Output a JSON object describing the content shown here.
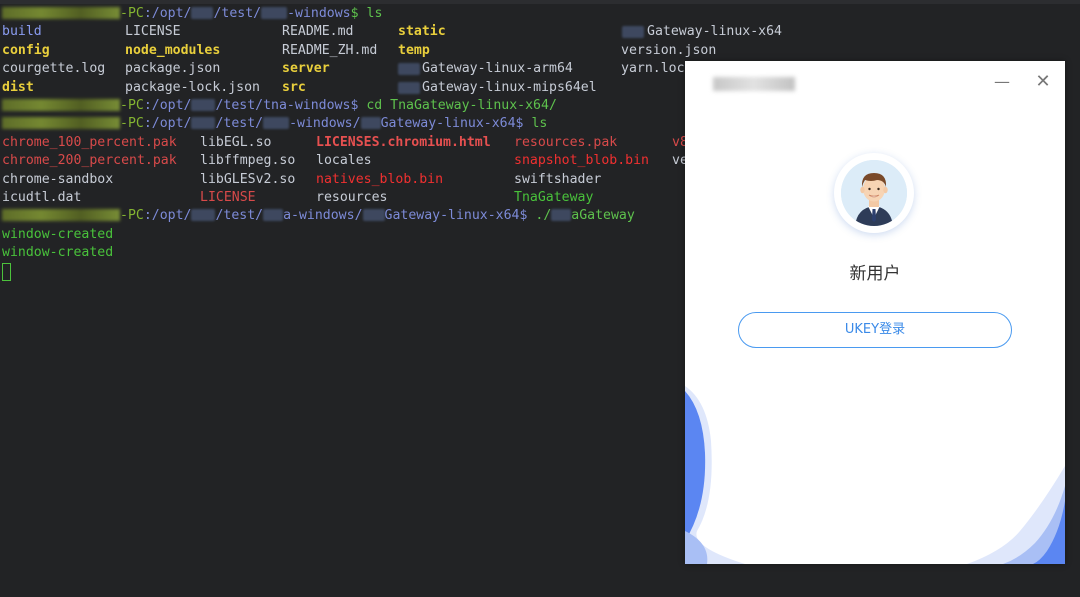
{
  "terminal": {
    "lines": [
      {
        "type": "prompt",
        "path": ":/opt/",
        "p2": "/test/",
        "p3": "-windows",
        "cmd": "$ ls"
      },
      {
        "type": "files",
        "cols": [
          {
            "text": "build",
            "cls": "fileb"
          },
          {
            "text": "LICENSE",
            "cls": "white"
          },
          {
            "text": "README.md",
            "cls": "white"
          },
          {
            "text": "static",
            "cls": "dir"
          },
          {
            "text": "Gateway-linux-x64",
            "cls": "white"
          }
        ]
      },
      {
        "type": "files",
        "cols": [
          {
            "text": "config",
            "cls": "dir"
          },
          {
            "text": "node_modules",
            "cls": "dir"
          },
          {
            "text": "README_ZH.md",
            "cls": "white"
          },
          {
            "text": "temp",
            "cls": "dir"
          },
          {
            "text": "version.json",
            "cls": "white"
          }
        ]
      },
      {
        "type": "files",
        "cols": [
          {
            "text": "courgette.log",
            "cls": "white"
          },
          {
            "text": "package.json",
            "cls": "white"
          },
          {
            "text": "server",
            "cls": "dir"
          },
          {
            "text": "Gateway-linux-arm64",
            "cls": "white"
          },
          {
            "text": "yarn.loc",
            "cls": "white"
          }
        ]
      },
      {
        "type": "files",
        "cols": [
          {
            "text": "dist",
            "cls": "dir"
          },
          {
            "text": "package-lock.json",
            "cls": "white"
          },
          {
            "text": "src",
            "cls": "dir"
          },
          {
            "text": "Gateway-linux-mips64el",
            "cls": "white"
          }
        ]
      },
      {
        "type": "prompt2",
        "text1": "-PC",
        "text2": ":/opt/",
        "text3": "/test/tna-windows$ ",
        "cmd": "cd TnaGateway-linux-x64/"
      },
      {
        "type": "prompt3",
        "text1": "-PC",
        "text2": ":/opt/",
        "text3": "/test/",
        "text4": "-windows/",
        "text5": "Gateway-linux-x64$ ",
        "cmd": "ls"
      },
      {
        "type": "files2",
        "cols": [
          {
            "text": "chrome_100_percent.pak",
            "cls": "red"
          },
          {
            "text": "libEGL.so",
            "cls": "white"
          },
          {
            "text": "LICENSES.chromium.html",
            "cls": "redb"
          },
          {
            "text": "resources.pak",
            "cls": "red"
          },
          {
            "text": "v8",
            "cls": "red"
          }
        ]
      },
      {
        "type": "files2",
        "cols": [
          {
            "text": "chrome_200_percent.pak",
            "cls": "red"
          },
          {
            "text": "libffmpeg.so",
            "cls": "white"
          },
          {
            "text": "locales",
            "cls": "white"
          },
          {
            "text": "snapshot_blob.bin",
            "cls": "brightred"
          },
          {
            "text": "ve",
            "cls": "white"
          }
        ]
      },
      {
        "type": "files2",
        "cols": [
          {
            "text": "chrome-sandbox",
            "cls": "white"
          },
          {
            "text": "libGLESv2.so",
            "cls": "white"
          },
          {
            "text": "natives_blob.bin",
            "cls": "brightred"
          },
          {
            "text": "swiftshader",
            "cls": "white"
          }
        ]
      },
      {
        "type": "files2",
        "cols": [
          {
            "text": "icudtl.dat",
            "cls": "white"
          },
          {
            "text": "LICENSE",
            "cls": "red"
          },
          {
            "text": "resources",
            "cls": "white"
          },
          {
            "text": "TnaGateway",
            "cls": "green"
          }
        ]
      },
      {
        "type": "prompt4",
        "text1": "-PC",
        "text2": ":/opt/",
        "text3": "/test/",
        "text4": "a-windows/",
        "text5": "Gateway-linux-x64$ ",
        "cmd": "./",
        "cmd2": "aGateway"
      },
      {
        "type": "out",
        "text": "window-created"
      },
      {
        "type": "out",
        "text": "window-created"
      }
    ]
  },
  "dialog": {
    "minimize_icon": "minimize-icon",
    "close_icon": "close-icon",
    "username": "新用户",
    "ukey_button": "UKEY登录",
    "accent": "#4a9af0",
    "wave_color": "#5b86f2"
  }
}
